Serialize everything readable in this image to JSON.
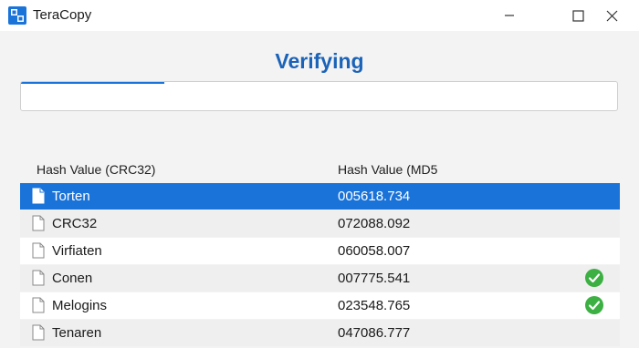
{
  "window": {
    "title": "TeraCopy",
    "icon": "teracopy-logo",
    "controls": [
      "minimize-icon",
      "maximize-icon",
      "close-icon"
    ]
  },
  "main": {
    "heading": "Verifying",
    "progress": 0.24
  },
  "table": {
    "headers": {
      "name": "Hash Value (CRC32)",
      "hash": "Hash Value (MD5"
    },
    "rows": [
      {
        "name": "Torten",
        "hash": "005618.734",
        "selected": true,
        "verified": false
      },
      {
        "name": "CRC32",
        "hash": "072088.092",
        "selected": false,
        "verified": false
      },
      {
        "name": "Virfiaten",
        "hash": "060058.007",
        "selected": false,
        "verified": false
      },
      {
        "name": "Conen",
        "hash": "007775.541",
        "selected": false,
        "verified": true
      },
      {
        "name": "Melogins",
        "hash": "023548.765",
        "selected": false,
        "verified": true
      },
      {
        "name": "Tenaren",
        "hash": "047086.777",
        "selected": false,
        "verified": false
      }
    ]
  },
  "colors": {
    "accent": "#1a73d9",
    "heading": "#1b63b8",
    "success": "#3cb043"
  }
}
